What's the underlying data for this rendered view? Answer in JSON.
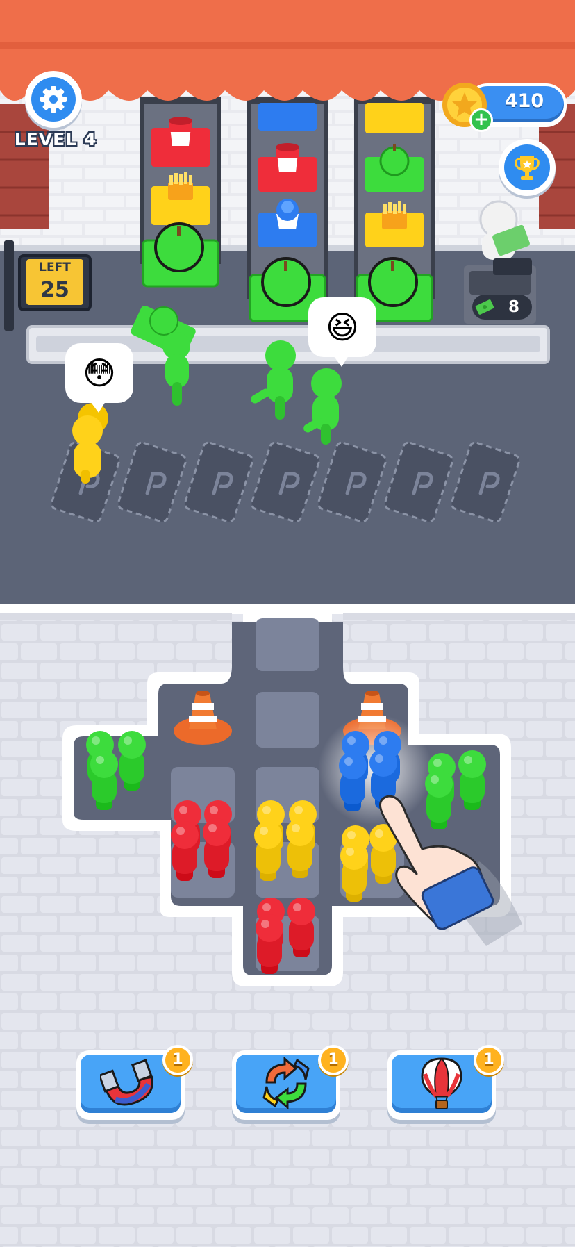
{
  "hud": {
    "level_label": "LEVEL 4",
    "coin_value": "410",
    "left_label": "LEFT",
    "left_value": "25",
    "cash_count": "8"
  },
  "boosters": [
    {
      "icon": "magnet-icon",
      "count": "1"
    },
    {
      "icon": "shuffle-icon",
      "count": "1"
    },
    {
      "icon": "hot-air-balloon-icon",
      "count": "1"
    }
  ],
  "colors": {
    "awning": "#ef6e4a",
    "road": "#5c6477",
    "plaza": "#d9dbe4",
    "green": "#3ddc3d",
    "red": "#ef2d3a",
    "yellow": "#ffd21a",
    "blue": "#2d7cf0",
    "ui_blue": "#2f8cf0"
  },
  "bubbles": [
    {
      "emoji": "😳"
    },
    {
      "emoji": "😆"
    }
  ]
}
